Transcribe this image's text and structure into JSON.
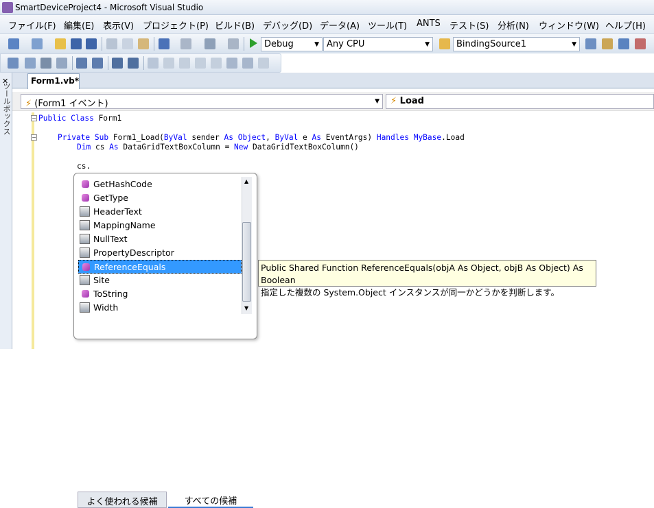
{
  "window": {
    "title": "SmartDeviceProject4 - Microsoft Visual Studio"
  },
  "menu": [
    "ファイル(F)",
    "編集(E)",
    "表示(V)",
    "プロジェクト(P)",
    "ビルド(B)",
    "デバッグ(D)",
    "データ(A)",
    "ツール(T)",
    "ANTS",
    "テスト(S)",
    "分析(N)",
    "ウィンドウ(W)",
    "ヘルプ(H)"
  ],
  "toolbar": {
    "config": "Debug",
    "platform": "Any CPU",
    "binding": "BindingSource1"
  },
  "toolbox_label": "ツールボックス",
  "tab": {
    "label": "Form1.vb*"
  },
  "nav": {
    "left": "(Form1 イベント)",
    "right": "Load"
  },
  "code": {
    "l1a": "Public Class ",
    "l1b": "Form1",
    "l2a": "Private Sub ",
    "l2b": "Form1_Load(",
    "l2c": "ByVal ",
    "l2d": "sender ",
    "l2e": "As Object",
    "l2f": ", ",
    "l2g": "ByVal ",
    "l2h": "e ",
    "l2i": "As ",
    "l2j": "EventArgs) ",
    "l2k": "Handles MyBase",
    ".l2l": "",
    "l2m": ".Load",
    "l3a": "Dim ",
    "l3b": "cs ",
    "l3c": "As ",
    "l3d": "DataGridTextBoxColumn = ",
    "l3e": "New ",
    "l3f": "DataGridTextBoxColumn()",
    "l4": "cs."
  },
  "completion": {
    "items": [
      {
        "label": "GetHashCode",
        "icon": "method-icon"
      },
      {
        "label": "GetType",
        "icon": "method-icon"
      },
      {
        "label": "HeaderText",
        "icon": "property-icon"
      },
      {
        "label": "MappingName",
        "icon": "property-icon"
      },
      {
        "label": "NullText",
        "icon": "property-icon"
      },
      {
        "label": "PropertyDescriptor",
        "icon": "property-icon"
      },
      {
        "label": "ReferenceEquals",
        "icon": "method-icon"
      },
      {
        "label": "Site",
        "icon": "property-icon"
      },
      {
        "label": "ToString",
        "icon": "method-icon"
      },
      {
        "label": "Width",
        "icon": "property-icon"
      }
    ],
    "selected_index": 6,
    "tab_common": "よく使われる候補",
    "tab_all": "すべての候補"
  },
  "tooltip": {
    "line1": "Public Shared Function ReferenceEquals(objA As Object, objB As Object) As Boolean",
    "line2": "指定した複数の System.Object インスタンスが同一かどうかを判断します。"
  }
}
